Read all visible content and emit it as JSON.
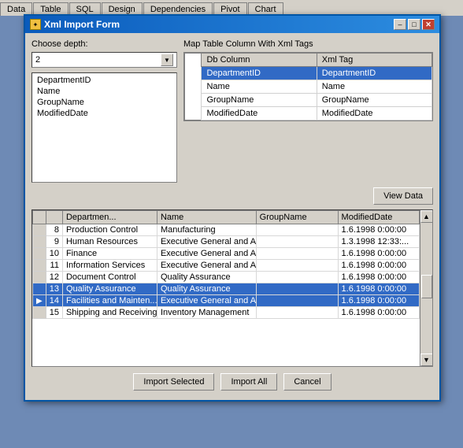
{
  "tabBar": {
    "tabs": [
      "Data",
      "Table",
      "SQL",
      "Design",
      "Dependencies",
      "Pivot",
      "Chart"
    ]
  },
  "dialog": {
    "title": "Xml Import Form",
    "depth_label": "Choose depth:",
    "depth_value": "2",
    "map_label": "Map Table Column With Xml Tags",
    "columns_label": "Db Column",
    "xmltag_label": "Xml Tag",
    "fields": [
      {
        "db": "DepartmentID",
        "xml": "DepartmentID",
        "selected": true
      },
      {
        "db": "Name",
        "xml": "Name"
      },
      {
        "db": "GroupName",
        "xml": "GroupName"
      },
      {
        "db": "ModifiedDate",
        "xml": "ModifiedDate"
      }
    ],
    "list_items": [
      "DepartmentID",
      "Name",
      "GroupName",
      "ModifiedDate"
    ],
    "view_data_btn": "View Data",
    "grid_headers": [
      "Departmen...",
      "Name",
      "GroupName",
      "ModifiedDate"
    ],
    "grid_rows": [
      {
        "indicator": "",
        "id": "8",
        "name": "Production Control",
        "group": "Manufacturing",
        "date": "1.6.1998 0:00:00",
        "selected": false,
        "current": false
      },
      {
        "indicator": "",
        "id": "9",
        "name": "Human Resources",
        "group": "Executive General and A...",
        "date": "1.3.1998 12:33:...",
        "selected": false,
        "current": false
      },
      {
        "indicator": "",
        "id": "10",
        "name": "Finance",
        "group": "Executive General and A...",
        "date": "1.6.1998 0:00:00",
        "selected": false,
        "current": false
      },
      {
        "indicator": "",
        "id": "11",
        "name": "Information Services",
        "group": "Executive General and A...",
        "date": "1.6.1998 0:00:00",
        "selected": false,
        "current": false
      },
      {
        "indicator": "",
        "id": "12",
        "name": "Document Control",
        "group": "Quality Assurance",
        "date": "1.6.1998 0:00:00",
        "selected": false,
        "current": false
      },
      {
        "indicator": "",
        "id": "13",
        "name": "Quality Assurance",
        "group": "Quality Assurance",
        "date": "1.6.1998 0:00:00",
        "selected": true,
        "current": false
      },
      {
        "indicator": "▶",
        "id": "14",
        "name": "Facilities and Mainten...",
        "group": "Executive General and A...",
        "date": "1.6.1998 0:00:00",
        "selected": true,
        "current": true
      },
      {
        "indicator": "",
        "id": "15",
        "name": "Shipping and Receiving",
        "group": "Inventory Management",
        "date": "1.6.1998 0:00:00",
        "selected": false,
        "current": false
      }
    ],
    "buttons": {
      "import_selected": "Import Selected",
      "import_all": "Import All",
      "cancel": "Cancel"
    }
  }
}
